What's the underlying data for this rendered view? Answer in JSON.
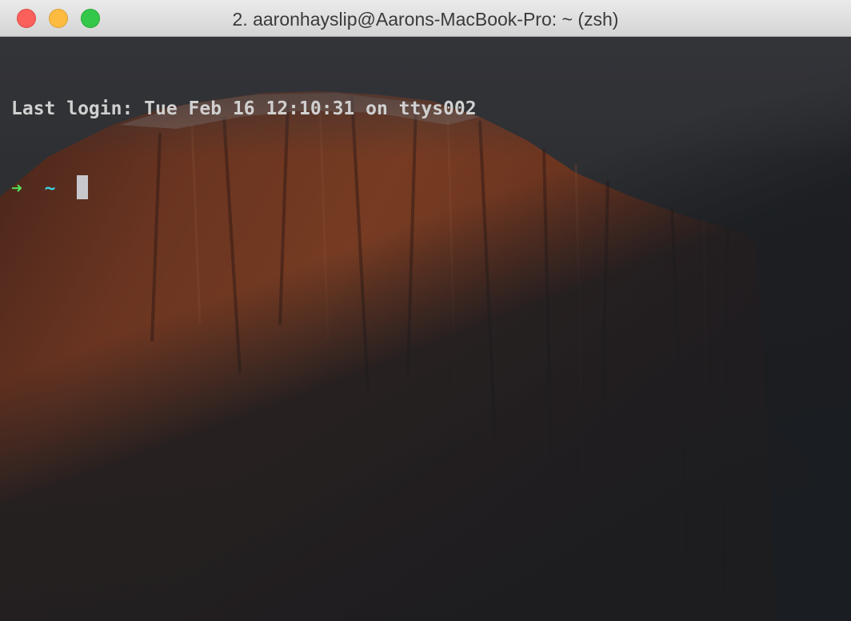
{
  "window": {
    "title": "2. aaronhayslip@Aarons-MacBook-Pro: ~ (zsh)",
    "buttons": {
      "close_color": "#fc605b",
      "minimize_color": "#fdbc40",
      "maximize_color": "#34c84a"
    }
  },
  "terminal": {
    "last_login": "Last login: Tue Feb 16 12:10:31 on ttys002",
    "prompt_arrow": "➜",
    "prompt_dir": "~",
    "arrow_color": "#4fe35a",
    "dir_color": "#3fd0e0"
  },
  "background": {
    "image": "El Capitan wallpaper"
  }
}
